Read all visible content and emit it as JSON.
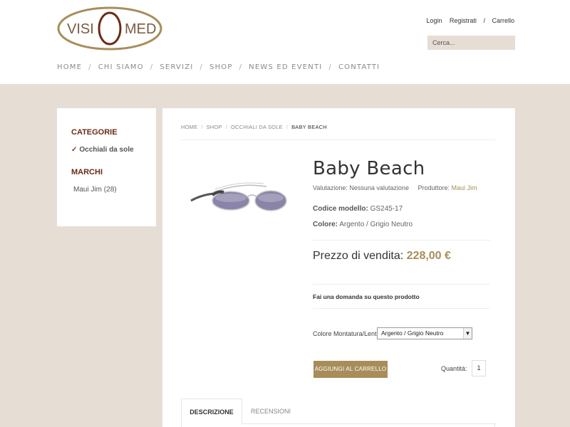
{
  "brand": {
    "logo_left": "VISI",
    "logo_o": "O",
    "logo_right": "MED",
    "accent": "#a88d5a",
    "dark_accent": "#6b2a15"
  },
  "top_links": {
    "login": "Login",
    "register": "Registrati",
    "sep": "/",
    "cart": "Carrello"
  },
  "search": {
    "placeholder": "Cerca..."
  },
  "nav": {
    "items": [
      "HOME",
      "CHI SIAMO",
      "SERVIZI",
      "SHOP",
      "NEWS ED EVENTI",
      "CONTATTI"
    ],
    "sep": "/"
  },
  "sidebar": {
    "categories_title": "CATEGORIE",
    "category_check": "✓",
    "category": "Occhiali da sole",
    "brands_title": "MARCHI",
    "brand": "Maui Jim",
    "brand_count": "(28)"
  },
  "breadcrumb": {
    "items": [
      "HOME",
      "SHOP",
      "OCCHIALI DA SOLE"
    ],
    "current": "BABY BEACH",
    "sep": "/"
  },
  "product": {
    "title": "Baby Beach",
    "rating_label": "Valutazione:",
    "rating_value": "Nessuna valutazione",
    "producer_label": "Produttore:",
    "producer_value": "Maui Jim",
    "model_label": "Codice modello:",
    "model_value": "GS245-17",
    "color_label": "Colore:",
    "color_value": "Argento / Grigio Neutro",
    "price_label": "Prezzo di vendita:",
    "price_value": "228,00 €",
    "ask": "Fai una domanda su questo prodotto",
    "option_label": "Colore Montatura/Lenti",
    "option_value": "Argento / Grigio Neutro",
    "add_to_cart": "AGGIUNGI AL CARRELLO",
    "qty_label": "Quantità:",
    "qty_value": "1"
  },
  "tabs": {
    "description": "DESCRIZIONE",
    "reviews": "RECENSIONI"
  }
}
